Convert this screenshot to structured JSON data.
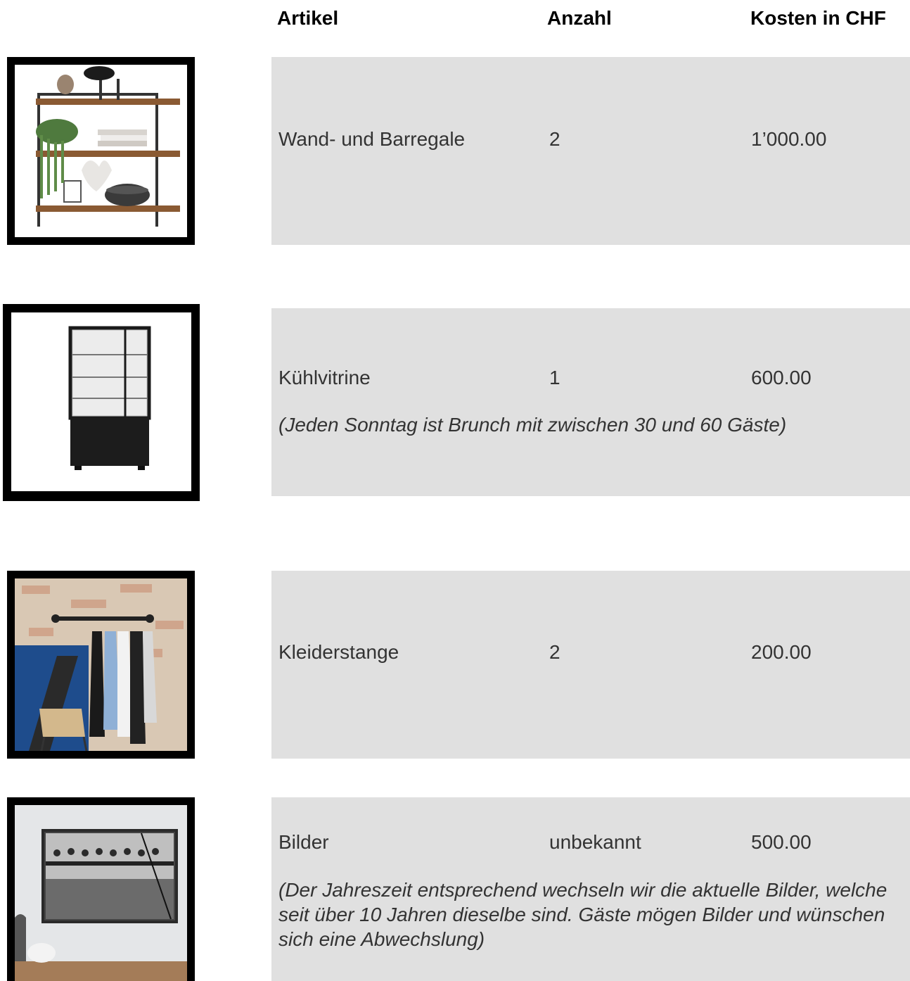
{
  "header": {
    "artikel": "Artikel",
    "anzahl": "Anzahl",
    "kosten": "Kosten in CHF"
  },
  "rows": [
    {
      "artikel": "Wand- und Barregale",
      "anzahl": "2",
      "kosten": "1’000.00",
      "note": "",
      "image": "shelf-image"
    },
    {
      "artikel": "Kühlvitrine",
      "anzahl": "1",
      "kosten": "600.00",
      "note": "(Jeden Sonntag ist Brunch mit zwischen 30 und 60 Gäste)",
      "image": "display-fridge-image"
    },
    {
      "artikel": "Kleiderstange",
      "anzahl": "2",
      "kosten": "200.00",
      "note": "",
      "image": "clothes-rack-image"
    },
    {
      "artikel": "Bilder",
      "anzahl": "unbekannt",
      "kosten": "500.00",
      "note": "(Der Jahreszeit entsprechend wechseln wir die aktuelle Bilder, welche seit über 10 Jahren dieselbe sind. Gäste mögen Bilder und wünschen sich eine Abwechslung)",
      "image": "pictures-image"
    }
  ],
  "colors": {
    "row_bg": "#e0e0e0",
    "frame": "#000000",
    "text": "#333333"
  }
}
